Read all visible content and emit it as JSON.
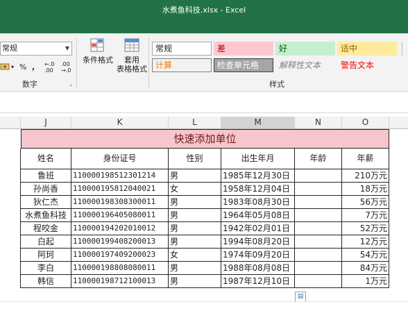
{
  "window": {
    "title": "水煮鱼科技.xlsx  -  Excel"
  },
  "ribbon": {
    "number_format_value": "常规",
    "number_buttons": {
      "currency": "",
      "percent": "%",
      "comma": ",",
      "inc_decimal": "←.0\n.00",
      "dec_decimal": ".00\n→.0"
    },
    "number_group_label": "数字",
    "conditional_format_label": "条件格式",
    "table_format_label_1": "套用",
    "table_format_label_2": "表格格式",
    "styles_group_label": "样式",
    "styles": [
      {
        "name": "常规",
        "bg": "#ffffff",
        "color": "#222222",
        "border": "#a8a8a8"
      },
      {
        "name": "差",
        "bg": "#ffc7ce",
        "color": "#9c0006",
        "border": "transparent"
      },
      {
        "name": "好",
        "bg": "#c6efce",
        "color": "#006100",
        "border": "transparent"
      },
      {
        "name": "适中",
        "bg": "#ffeb9c",
        "color": "#9c5700",
        "border": "transparent"
      },
      {
        "name": "计算",
        "bg": "#f2f2f2",
        "color": "#fa7d00",
        "border": "#7f7f7f"
      },
      {
        "name": "检查单元格",
        "bg": "#a5a5a5",
        "color": "#ffffff",
        "border": "#3f3f3f"
      },
      {
        "name": "解释性文本",
        "bg": "transparent",
        "color": "#7f7f7f",
        "border": "transparent"
      },
      {
        "name": "警告文本",
        "bg": "transparent",
        "color": "#ff0000",
        "border": "transparent"
      }
    ]
  },
  "sheet": {
    "columns": [
      "J",
      "K",
      "L",
      "M",
      "N",
      "O"
    ],
    "selected_column": "M",
    "banner": "快速添加单位",
    "headers": [
      "姓名",
      "身份证号",
      "性别",
      "出生年月",
      "年龄",
      "年薪"
    ],
    "rows": [
      [
        "鲁班",
        "110000198512301214",
        "男",
        "1985年12月30日",
        "",
        "210万元"
      ],
      [
        "孙尚香",
        "110000195812040021",
        "女",
        "1958年12月04日",
        "",
        "18万元"
      ],
      [
        "狄仁杰",
        "110000198308300011",
        "男",
        "1983年08月30日",
        "",
        "56万元"
      ],
      [
        "水煮鱼科技",
        "110000196405080011",
        "男",
        "1964年05月08日",
        "",
        "7万元"
      ],
      [
        "程咬金",
        "110000194202010012",
        "男",
        "1942年02月01日",
        "",
        "52万元"
      ],
      [
        "白起",
        "110000199408200013",
        "男",
        "1994年08月20日",
        "",
        "12万元"
      ],
      [
        "阿珂",
        "110000197409200023",
        "女",
        "1974年09月20日",
        "",
        "54万元"
      ],
      [
        "李白",
        "110000198808080011",
        "男",
        "1988年08月08日",
        "",
        "84万元"
      ],
      [
        "韩信",
        "110000198712100013",
        "男",
        "1987年12月10日",
        "",
        "1万元"
      ]
    ]
  },
  "colors": {
    "excel_green": "#217346",
    "banner_bg": "#f7c6cc"
  }
}
